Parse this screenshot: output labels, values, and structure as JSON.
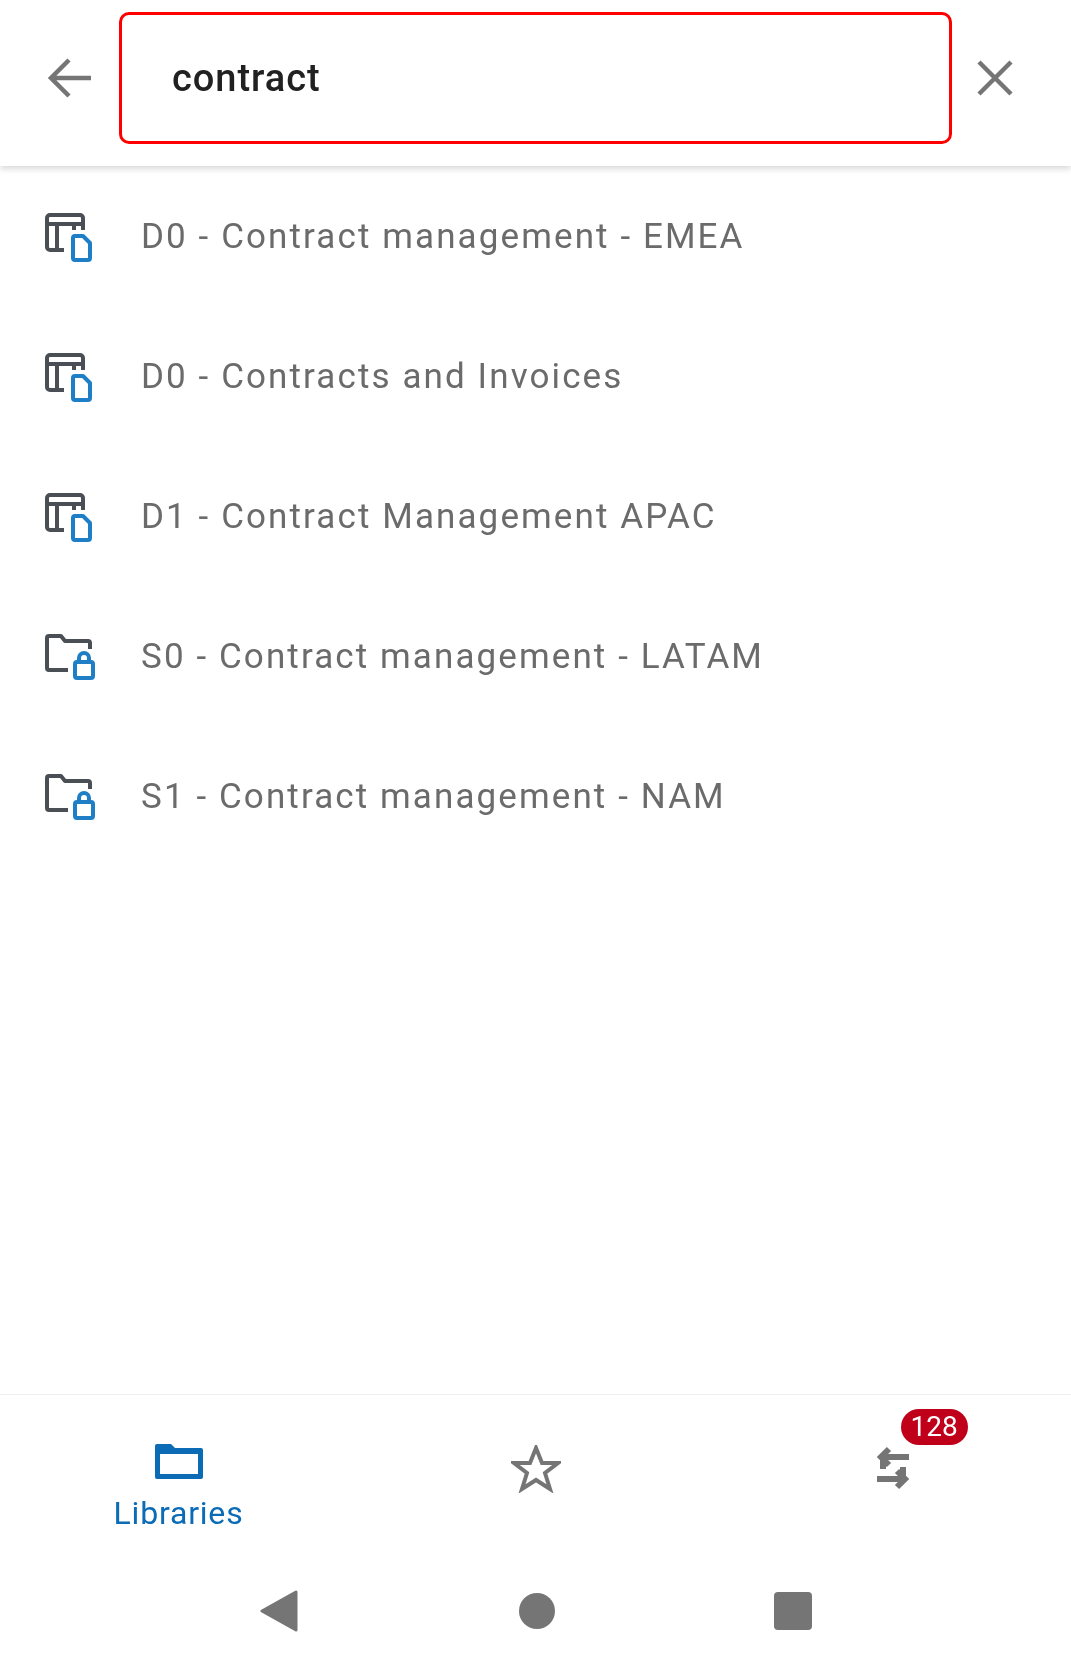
{
  "search": {
    "value": "contract"
  },
  "results": [
    {
      "kind": "library",
      "label": "D0 - Contract management - EMEA"
    },
    {
      "kind": "library",
      "label": "D0 - Contracts and Invoices"
    },
    {
      "kind": "library",
      "label": "D1 - Contract Management APAC"
    },
    {
      "kind": "site",
      "label": "S0 - Contract management - LATAM"
    },
    {
      "kind": "site",
      "label": "S1 - Contract management - NAM"
    }
  ],
  "bottom_nav": [
    {
      "kind": "libraries",
      "label": "Libraries",
      "selected": true
    },
    {
      "kind": "favorites",
      "selected": false
    },
    {
      "kind": "sync",
      "selected": false,
      "badge": "128"
    }
  ]
}
